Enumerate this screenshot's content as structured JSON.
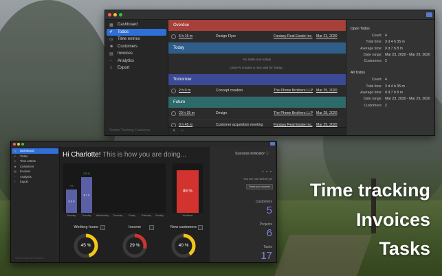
{
  "window1": {
    "sidebar": [
      {
        "icon": "dashboard-icon",
        "glyph": "▦",
        "label": "Dashboard"
      },
      {
        "icon": "check-icon",
        "glyph": "✔",
        "label": "Todos",
        "active": true
      },
      {
        "icon": "clock-icon",
        "glyph": "◷",
        "label": "Time entries"
      },
      {
        "icon": "people-icon",
        "glyph": "☻",
        "label": "Customers"
      },
      {
        "icon": "invoice-icon",
        "glyph": "▤",
        "label": "Invoices"
      },
      {
        "icon": "analytics-icon",
        "glyph": "◔",
        "label": "Analytics"
      },
      {
        "icon": "export-icon",
        "glyph": "⇪",
        "label": "Export"
      }
    ],
    "footer": "Simple Tracking Freelance",
    "sections": {
      "overdue": "Overdue",
      "today": "Today",
      "tomorrow": "Tomorrow",
      "future": "Future"
    },
    "overdue_rows": [
      {
        "duration": "5 h 15 m",
        "task": "Design Flyer",
        "customer": "Fantasy Real Estate Inc.",
        "date": "Mar 23, 2020"
      }
    ],
    "today_empty": "No tasks due today!",
    "today_hint": "CMD+N creates a new task for Today...",
    "tomorrow_rows": [
      {
        "duration": "2 h 0 m",
        "task": "Concept creation",
        "customer": "The Phone Brothers LLP",
        "date": "Mar 25, 2020"
      }
    ],
    "future_rows": [
      {
        "duration": "20 h 35 m",
        "task": "Design",
        "customer": "The Phone Brothers LLP",
        "date": "Mar 28, 2020"
      },
      {
        "duration": "0 h 45 m",
        "task": "Customer acquisition meeting",
        "customer": "Fantasy Real Estate Inc.",
        "date": "Mar 29, 2020"
      }
    ],
    "bottom_add": "+",
    "bottom_remove": "−",
    "open_todos": {
      "title": "Open Todos",
      "rows": [
        {
          "k": "Count:",
          "v": "4"
        },
        {
          "k": "Total time:",
          "v": "3 d 4 h 35 m"
        },
        {
          "k": "Average time:",
          "v": "0 d 7 h 8 m"
        },
        {
          "k": "Date range:",
          "v": "Mar 23, 2020 - Mar 29, 2020"
        },
        {
          "k": "Customers:",
          "v": "2"
        }
      ]
    },
    "all_todos": {
      "title": "All Todos",
      "rows": [
        {
          "k": "Count:",
          "v": "4"
        },
        {
          "k": "Total time:",
          "v": "3 d 4 h 35 m"
        },
        {
          "k": "Average time:",
          "v": "0 d 7 h 8 m"
        },
        {
          "k": "Date range:",
          "v": "Mar 23, 2020 - Mar 29, 2020"
        },
        {
          "k": "Customers:",
          "v": "2"
        }
      ]
    }
  },
  "window2": {
    "sidebar": [
      {
        "glyph": "▦",
        "label": "Dashboard",
        "active": true
      },
      {
        "glyph": "✔",
        "label": "Todos"
      },
      {
        "glyph": "◷",
        "label": "Time entries"
      },
      {
        "glyph": "☻",
        "label": "Customers"
      },
      {
        "glyph": "▤",
        "label": "Invoices"
      },
      {
        "glyph": "◔",
        "label": "Analytics"
      },
      {
        "glyph": "⇪",
        "label": "Export"
      }
    ],
    "footer": "Simple Tracking Freelance",
    "greeting": "Hi Charlotte!",
    "greeting_sub": "This is how you are doing...",
    "weekdays": [
      "Monday",
      "Tuesday",
      "Wednesday",
      "Thursday",
      "Friday",
      "Saturday",
      "Sunday"
    ],
    "week_bars": [
      {
        "label": "5.0 h",
        "pct": "+%",
        "fraction": 0.48
      },
      {
        "label": "8.7 h",
        "pct": "105 %",
        "fraction": 0.8
      }
    ],
    "workload": {
      "label": "Workload",
      "value": "89 %"
    },
    "gauges": [
      {
        "title": "Working hours",
        "value": "45 %",
        "fraction": 0.45,
        "color": "#f5c518"
      },
      {
        "title": "Income",
        "value": "29 %",
        "fraction": 0.29,
        "color": "#d2332f"
      },
      {
        "title": "New customers",
        "value": "40 %",
        "fraction": 0.4,
        "color": "#f5c518"
      }
    ],
    "success": {
      "title": "Success indicator",
      "dots": "• • •",
      "not_ranked": "You are not ranked yet",
      "share": "Share your success"
    },
    "kpis": [
      {
        "label": "Customers",
        "value": "5"
      },
      {
        "label": "Projects",
        "value": "6"
      },
      {
        "label": "Tasks",
        "value": "17"
      }
    ]
  },
  "promo": [
    "Time tracking",
    "Invoices",
    "Tasks"
  ]
}
